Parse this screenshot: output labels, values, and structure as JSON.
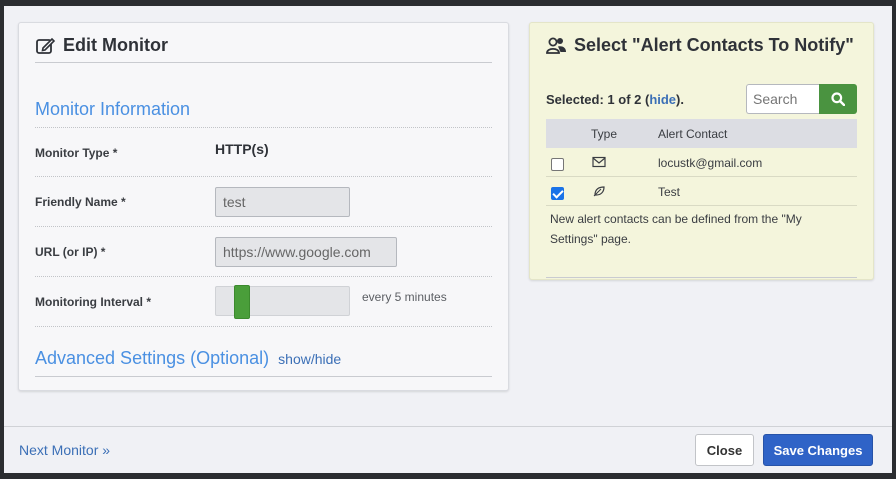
{
  "edit_monitor": {
    "title": "Edit Monitor",
    "section_monitor_info": "Monitor Information",
    "monitor_type_label": "Monitor Type *",
    "monitor_type_value": "HTTP(s)",
    "friendly_name_label": "Friendly Name *",
    "friendly_name_value": "test",
    "url_label": "URL (or IP) *",
    "url_value": "https://www.google.com",
    "interval_label": "Monitoring Interval *",
    "interval_text": "every 5 minutes",
    "interval_slider_fraction": 0.05,
    "advanced_label": "Advanced Settings (Optional)",
    "advanced_toggle": "show/hide"
  },
  "alert_contacts": {
    "title": "Select \"Alert Contacts To Notify\"",
    "selected_prefix": "Selected: 1 of 2 (",
    "hide_link": "hide",
    "selected_suffix": ").",
    "search_placeholder": "Search",
    "col_type": "Type",
    "col_contact": "Alert Contact",
    "rows": [
      {
        "checked": false,
        "type_icon": "envelope-icon",
        "contact": "locustk@gmail.com"
      },
      {
        "checked": true,
        "type_icon": "leaf-icon",
        "contact": "Test"
      }
    ],
    "note": "New alert contacts can be defined from the \"My Settings\" page."
  },
  "footer": {
    "next_monitor": "Next Monitor »",
    "close": "Close",
    "save": "Save Changes"
  },
  "colors": {
    "accent_blue": "#4a90e2",
    "save_button": "#2f63c7",
    "search_button": "#4a9340",
    "slider_thumb": "#4a9e3a"
  }
}
